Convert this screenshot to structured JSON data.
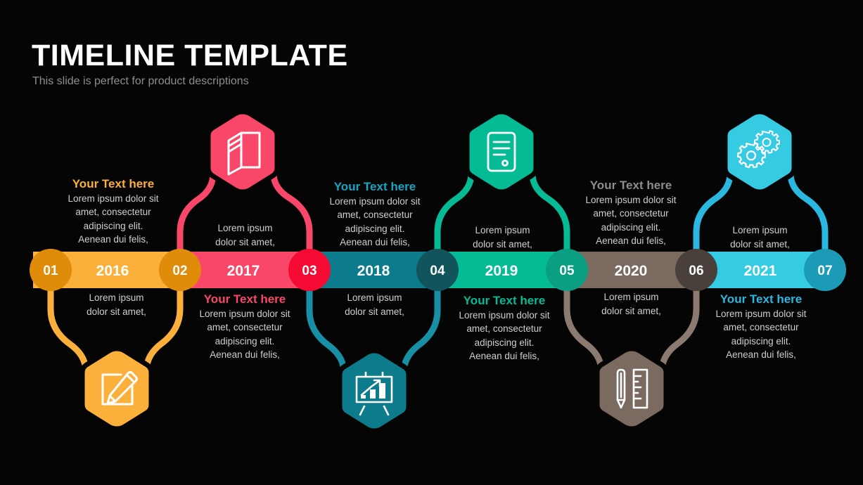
{
  "slide": {
    "title": "TIMELINE TEMPLATE",
    "subtitle": "This slide is perfect for product descriptions",
    "background": "#050505"
  },
  "common": {
    "heading": "Your  Text here",
    "body_lines": [
      "Lorem  ipsum dolor  sit",
      "amet,  consectetur",
      "adipiscing  elit.",
      "Aenean  dui felis,"
    ],
    "short_lines": [
      "Lorem  ipsum",
      "dolor sit amet,"
    ],
    "body_text_color": "#cfcfcf"
  },
  "steps": [
    {
      "number": "01",
      "year": "2016",
      "bar_color": "#fbb03b",
      "circle_color": "#e08c0b",
      "accent": "#fbb03b",
      "icon": "pencil-square-icon",
      "icon_side": "bottom",
      "text_side": "above",
      "text_style": "long",
      "heading": "Your  Text here",
      "heading_color": "#fbb03b"
    },
    {
      "number": "02",
      "year": "2017",
      "bar_color": "#f9476a",
      "circle_color": "#e8340c",
      "accent": "#f9476a",
      "icon": "book-icon",
      "icon_side": "top",
      "text_side": "below",
      "text_style": "long",
      "heading": "Your  Text here",
      "heading_color": "#f9476a"
    },
    {
      "number": "03",
      "year": "2018",
      "bar_color": "#0c7b8c",
      "circle_color": "#f50a33",
      "accent": "#16a5c4",
      "icon": "presentation-chart-icon",
      "icon_side": "bottom",
      "text_side": "above",
      "text_style": "long",
      "heading": "Your  Text here",
      "heading_color": "#16a5c4"
    },
    {
      "number": "04",
      "year": "2019",
      "bar_color": "#04bb96",
      "circle_color": "#12545b",
      "accent": "#04bb96",
      "icon": "document-icon",
      "icon_side": "top",
      "text_side": "below",
      "text_style": "long",
      "heading": "Your  Text here",
      "heading_color": "#04bb96"
    },
    {
      "number": "05",
      "year": "2020",
      "bar_color": "#7a6a60",
      "circle_color": "#0a9e82",
      "accent": "#8d8d8d",
      "icon": "ruler-pencil-icon",
      "icon_side": "bottom",
      "text_side": "above",
      "text_style": "long",
      "heading": "Your  Text here",
      "heading_color": "#8d8d8d"
    },
    {
      "number": "06",
      "year": "2021",
      "bar_color": "#35cbe2",
      "circle_color": "#4a403b",
      "accent": "#2ab7e0",
      "icon": "gears-icon",
      "icon_side": "top",
      "text_side": "below",
      "text_style": "long",
      "heading": "Your  Text here",
      "heading_color": "#2ab7e0"
    },
    {
      "number": "07",
      "year": "",
      "bar_color": "",
      "circle_color": "#1b9bb5",
      "accent": "#1b9bb5",
      "icon": "",
      "icon_side": "none",
      "text_side": "none",
      "text_style": "none",
      "heading": "",
      "heading_color": ""
    }
  ],
  "short_blocks": [
    {
      "for_year": "2017",
      "lines": [
        "Lorem  ipsum",
        "dolor sit amet,"
      ]
    },
    {
      "for_year": "2016",
      "lines": [
        "Lorem  ipsum",
        "dolor sit amet,"
      ]
    },
    {
      "for_year": "2019",
      "lines": [
        "Lorem  ipsum",
        "dolor sit amet,"
      ]
    },
    {
      "for_year": "2018",
      "lines": [
        "Lorem  ipsum",
        "dolor sit amet,"
      ]
    },
    {
      "for_year": "2021",
      "lines": [
        "Lorem  ipsum",
        "dolor sit amet,"
      ]
    },
    {
      "for_year": "2020",
      "lines": [
        "Lorem  ipsum",
        "dolor sit amet,"
      ]
    }
  ]
}
